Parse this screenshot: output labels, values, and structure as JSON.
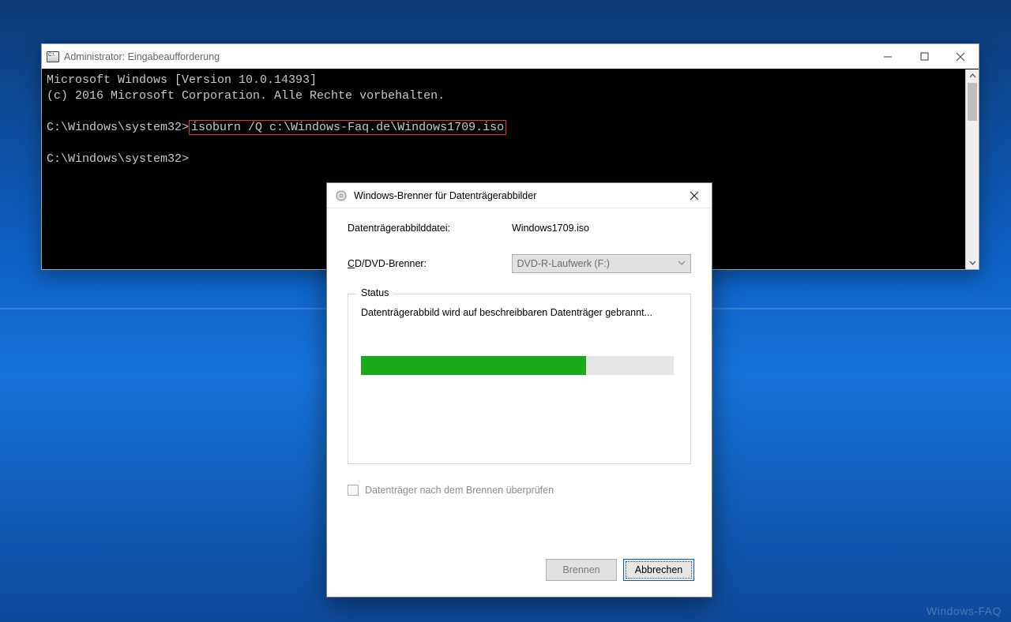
{
  "desktop": {
    "watermark": "Windows-FAQ"
  },
  "cmd": {
    "title": "Administrator: Eingabeaufforderung",
    "line1": "Microsoft Windows [Version 10.0.14393]",
    "line2": "(c) 2016 Microsoft Corporation. Alle Rechte vorbehalten.",
    "prompt1_prefix": "C:\\Windows\\system32>",
    "prompt1_cmd": "isoburn /Q c:\\Windows-Faq.de\\Windows1709.iso",
    "prompt2_prefix": "C:\\Windows\\system32>"
  },
  "dialog": {
    "title": "Windows-Brenner für Datenträgerabbilder",
    "file_label": "Datenträgerabbilddatei:",
    "file_value": "Windows1709.iso",
    "drive_label_pre": "",
    "drive_label_u": "C",
    "drive_label_post": "D/DVD-Brenner:",
    "drive_value": "DVD-R-Laufwerk (F:)",
    "status_legend": "Status",
    "status_text": "Datenträgerabbild wird auf beschreibbaren Datenträger gebrannt...",
    "progress_percent": 72,
    "verify_pre": "",
    "verify_u": "D",
    "verify_post": "atenträger nach dem Brennen überprüfen",
    "btn_burn_pre": "B",
    "btn_burn_u": "r",
    "btn_burn_post": "ennen",
    "btn_cancel_pre": "",
    "btn_cancel_u": "A",
    "btn_cancel_post": "bbrechen"
  }
}
